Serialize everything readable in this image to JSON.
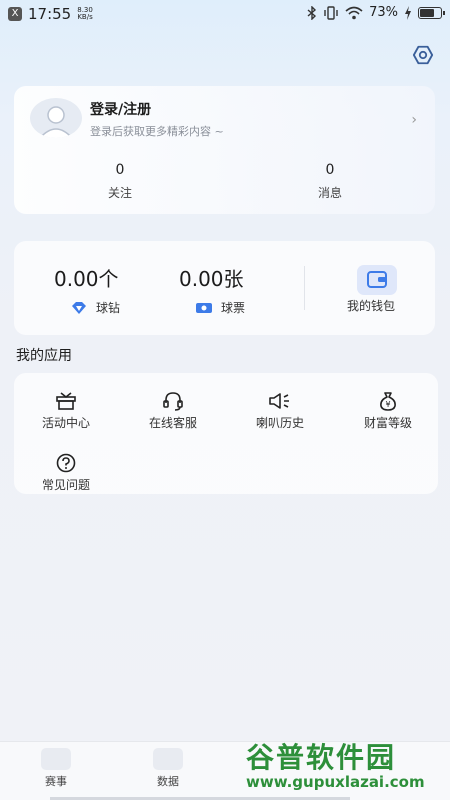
{
  "status_bar": {
    "close_glyph": "X",
    "time": "17:55",
    "net_speed_value": "8.30",
    "net_speed_unit": "KB/s",
    "battery_text": "73%",
    "battery_level": 0.73
  },
  "profile": {
    "login_title": "登录/注册",
    "login_subtitle": "登录后获取更多精彩内容 ~",
    "stats": [
      {
        "value": "0",
        "label": "关注"
      },
      {
        "value": "0",
        "label": "消息"
      }
    ]
  },
  "wallet": {
    "diamonds_value": "0.00个",
    "diamonds_label": "球钻",
    "tickets_value": "0.00张",
    "tickets_label": "球票",
    "my_wallet_label": "我的钱包"
  },
  "apps_section_title": "我的应用",
  "apps": [
    {
      "label": "活动中心",
      "icon": "gift-box-icon"
    },
    {
      "label": "在线客服",
      "icon": "headset-icon"
    },
    {
      "label": "喇叭历史",
      "icon": "speaker-icon"
    },
    {
      "label": "财富等级",
      "icon": "money-bag-icon"
    },
    {
      "label": "常见问题",
      "icon": "question-icon"
    }
  ],
  "tabs": [
    {
      "label": "赛事",
      "icon": "match-icon"
    },
    {
      "label": "数据",
      "icon": "chart-icon"
    }
  ],
  "watermark": {
    "title": "谷普软件园",
    "url": "www.gupuxlazai.com"
  },
  "colors": {
    "accent_blue": "#3d7be8",
    "watermark_green": "#2d8f3a"
  }
}
